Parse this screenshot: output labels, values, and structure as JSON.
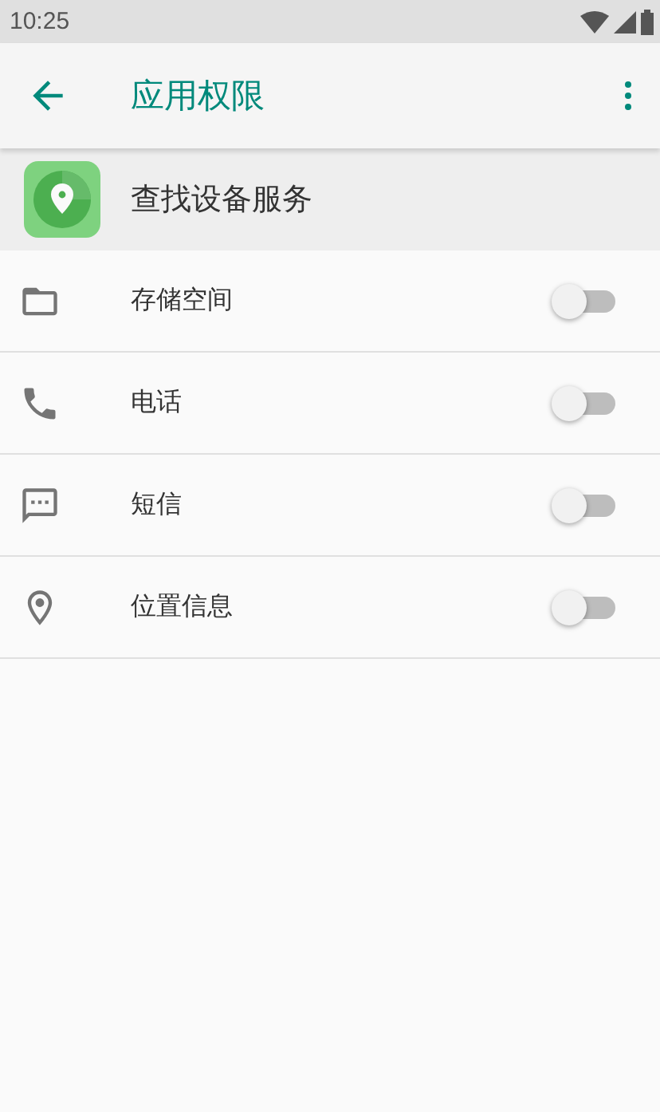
{
  "status_bar": {
    "time": "10:25"
  },
  "app_bar": {
    "title": "应用权限"
  },
  "app": {
    "name": "查找设备服务"
  },
  "permissions": [
    {
      "kind": "folder",
      "label": "存储空间",
      "on": false
    },
    {
      "kind": "phone",
      "label": "电话",
      "on": false
    },
    {
      "kind": "message",
      "label": "短信",
      "on": false
    },
    {
      "kind": "location",
      "label": "位置信息",
      "on": false
    }
  ]
}
